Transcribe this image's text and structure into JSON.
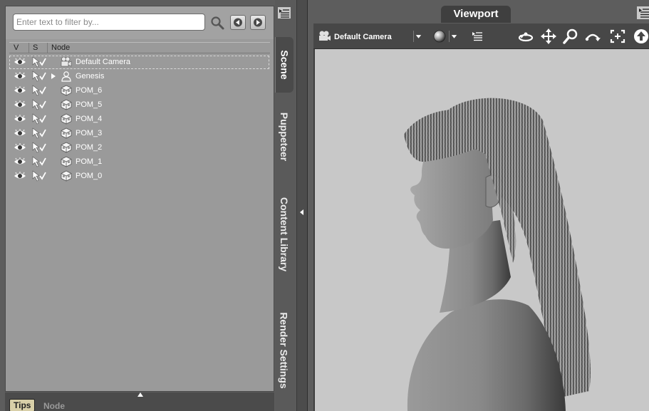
{
  "scene_panel": {
    "filter_placeholder": "Enter text to filter by...",
    "columns": {
      "v": "V",
      "s": "S",
      "node": "Node"
    },
    "nodes": [
      {
        "label": "Default Camera",
        "icon": "camera-icon",
        "selected": true
      },
      {
        "label": "Genesis",
        "icon": "figure-icon",
        "expandable": true
      },
      {
        "label": "POM_6",
        "icon": "prop-icon"
      },
      {
        "label": "POM_5",
        "icon": "prop-icon"
      },
      {
        "label": "POM_4",
        "icon": "prop-icon"
      },
      {
        "label": "POM_3",
        "icon": "prop-icon"
      },
      {
        "label": "POM_2",
        "icon": "prop-icon"
      },
      {
        "label": "POM_1",
        "icon": "prop-icon"
      },
      {
        "label": "POM_0",
        "icon": "prop-icon"
      }
    ]
  },
  "bottom_tabs": {
    "tips": "Tips",
    "node": "Node"
  },
  "side_tabs": [
    "Scene",
    "Puppeteer",
    "Content Library",
    "Render Settings"
  ],
  "viewport": {
    "tab_label": "Viewport",
    "camera_label": "Default Camera"
  },
  "colors": {
    "panel_bg": "#9a9a9a",
    "viewport_bg": "#c8c8c8",
    "tips_tab": "#d8cfa8"
  }
}
